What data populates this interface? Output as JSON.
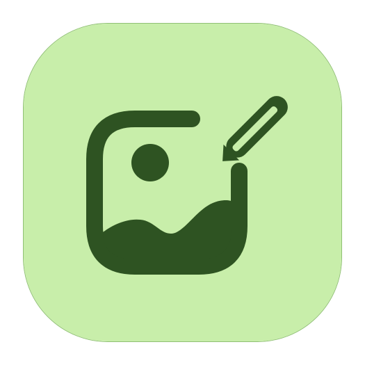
{
  "app_icon": {
    "icon": "image-edit-icon",
    "background_color": "#c8eeaa",
    "border_color": "#8fbf74",
    "glyph_color": "#2e5322"
  }
}
